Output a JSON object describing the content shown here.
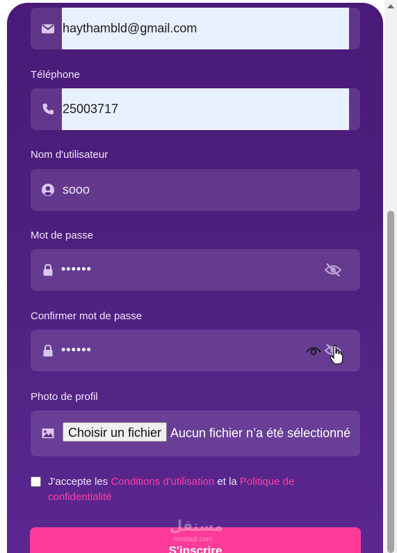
{
  "form": {
    "email": {
      "value": "haythambld@gmail.com",
      "icon": "envelope-icon"
    },
    "phone": {
      "label": "Téléphone",
      "value": "25003717",
      "icon": "phone-icon"
    },
    "username": {
      "label": "Nom d'utilisateur",
      "value": "sooo",
      "icon": "user-circle-icon"
    },
    "password": {
      "label": "Mot de passe",
      "masked_value": "••••••",
      "icon": "lock-icon",
      "toggle_icon": "eye-slash-icon"
    },
    "confirm_password": {
      "label": "Confirmer mot de passe",
      "masked_value": "••••••",
      "icon": "lock-icon",
      "toggle_icons": [
        "eye-icon",
        "eye-slash-icon"
      ]
    },
    "profile_photo": {
      "label": "Photo de profil",
      "button_label": "Choisir un fichier",
      "status": "Aucun fichier n’a été sélectionné",
      "icon": "image-icon"
    },
    "terms": {
      "prefix": "J'accepte les ",
      "conditions_link": "Conditions d'utilisation",
      "middle": " et la ",
      "privacy_link": "Politique de confidentialité",
      "checked": false
    },
    "submit_label": "S'inscrire"
  },
  "watermark": {
    "arabic": "مستقل",
    "latin": "mostaql.com"
  },
  "colors": {
    "card_top": "#4a1a78",
    "card_bottom": "#5a2890",
    "field_bg": "rgba(255,255,255,0.12)",
    "autofill_bg": "#e8f0fe",
    "accent_pink": "#ff3b9a",
    "link_pink": "#ff3da8",
    "label_text": "#f0e6fa"
  }
}
